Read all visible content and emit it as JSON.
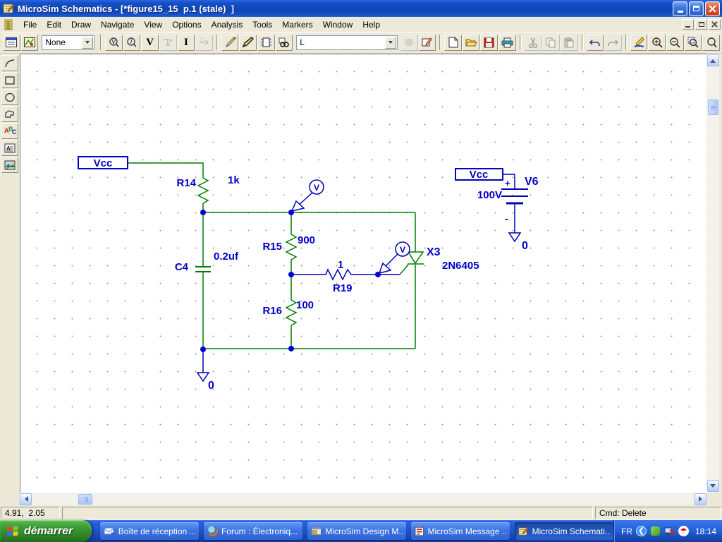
{
  "window": {
    "title": "MicroSim Schematics - [*figure15_15  p.1 (stale)  ]"
  },
  "menu": {
    "items": [
      {
        "label": "File"
      },
      {
        "label": "Edit"
      },
      {
        "label": "Draw"
      },
      {
        "label": "Navigate"
      },
      {
        "label": "View"
      },
      {
        "label": "Options"
      },
      {
        "label": "Analysis"
      },
      {
        "label": "Tools"
      },
      {
        "label": "Markers"
      },
      {
        "label": "Window"
      },
      {
        "label": "Help"
      }
    ]
  },
  "toolbar": {
    "none_combo": "None",
    "part_combo": "L",
    "v_label": "V",
    "i_label": "I"
  },
  "palette": {
    "abc": [
      "A",
      "B",
      "C"
    ],
    "text_letter": "A"
  },
  "schematic": {
    "vcc_left": "Vcc",
    "vcc_right": "Vcc",
    "gnd_left": "0",
    "gnd_right": "0",
    "probe_label": "V",
    "r14": {
      "ref": "R14",
      "value": "1k"
    },
    "r15": {
      "ref": "R15",
      "value": "900"
    },
    "r16": {
      "ref": "R16",
      "value": "100"
    },
    "r19": {
      "ref": "R19",
      "value": "1"
    },
    "c4": {
      "ref": "C4",
      "value": "0.2uf"
    },
    "x3": {
      "ref": "X3",
      "value": "2N6405"
    },
    "v6": {
      "ref": "V6",
      "value": "100V",
      "plus": "+",
      "minus": "-"
    },
    "colors": {
      "wire": "#007d00",
      "part_blue": "#0000c8",
      "junction": "#0000d2"
    }
  },
  "statusbar": {
    "coords": "4.91,  2.05",
    "cmd": "Cmd: Delete"
  },
  "taskbar": {
    "start_label": "démarrer",
    "lang": "FR",
    "clock": "18:14",
    "buttons": [
      {
        "label": "Boîte de réception ..."
      },
      {
        "label": "Forum : Électroniq..."
      },
      {
        "label": "MicroSim Design M..."
      },
      {
        "label": "MicroSim Message ..."
      },
      {
        "label": "MicroSim Schemati..."
      }
    ]
  },
  "icons": {
    "scroll_arrows": "triangles",
    "avira_umbrella": "☂",
    "outlook_envelope": "✉"
  }
}
